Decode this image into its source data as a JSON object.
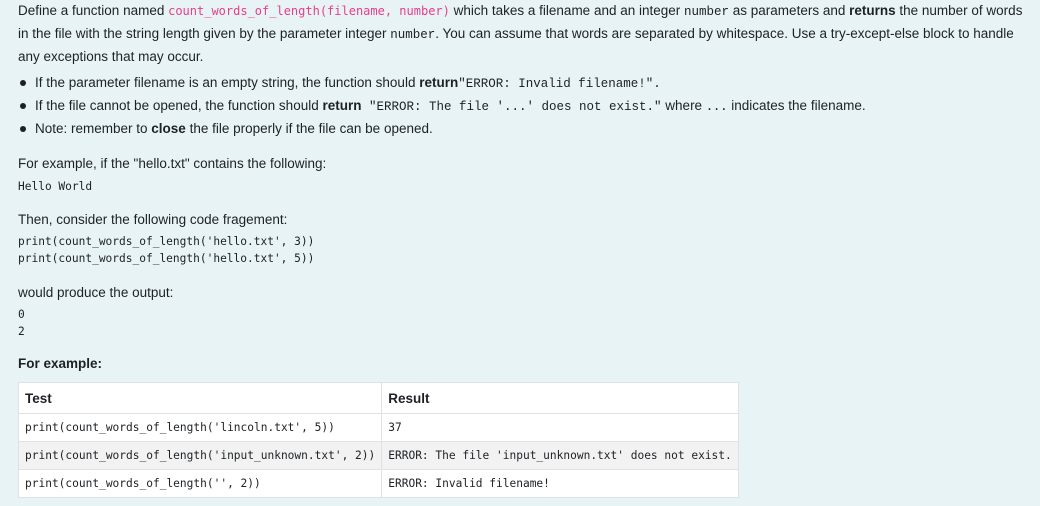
{
  "question": {
    "intro": {
      "t1": "Define a function named ",
      "func_sig": "count_words_of_length(filename, number)",
      "t2": " which takes a filename and an integer ",
      "number_code": "number",
      "t3": " as parameters and ",
      "returns_bold": "returns",
      "t4": " the number of words in the file with the string length given by the parameter integer ",
      "number_code2": "number",
      "t5": ". You can assume that words are separated by whitespace. Use a try-except-else block to handle any exceptions that may occur."
    },
    "bullets": [
      {
        "t1": "If the parameter filename is an empty string, the function should ",
        "bold": "return",
        "code": "\"ERROR: Invalid filename!\".",
        "t2": ""
      },
      {
        "t1": "If the file cannot be opened, the function should ",
        "bold": "return",
        "code": " \"ERROR: The file '...' does not exist.\"",
        "t2": " where ",
        "code2": "...",
        "t3": " indicates the filename."
      },
      {
        "t1": "Note: remember to ",
        "bold": "close",
        "t2": " the file properly if the file can be opened."
      }
    ],
    "example_intro": "For example, if the \"hello.txt\" contains the following:",
    "file_contents": "Hello World",
    "then_text": "Then, consider the following code fragement:",
    "code_lines": [
      "print(count_words_of_length('hello.txt', 3))",
      "print(count_words_of_length('hello.txt', 5))"
    ],
    "produce_text": "would produce the output:",
    "output_lines": [
      "0",
      "2"
    ],
    "for_example_label": "For example:"
  },
  "table": {
    "headers": [
      "Test",
      "Result"
    ],
    "rows": [
      {
        "test": "print(count_words_of_length('lincoln.txt', 5))",
        "result": "37"
      },
      {
        "test": "print(count_words_of_length('input_unknown.txt', 2))",
        "result": "ERROR: The file 'input_unknown.txt' does not exist."
      },
      {
        "test": "print(count_words_of_length('', 2))",
        "result": "ERROR: Invalid filename!"
      }
    ]
  },
  "colors": {
    "background": "#e7f3f5",
    "code_accent": "#e83e8c",
    "table_border": "#dee2e6",
    "row_alt": "#f2f2f2"
  }
}
